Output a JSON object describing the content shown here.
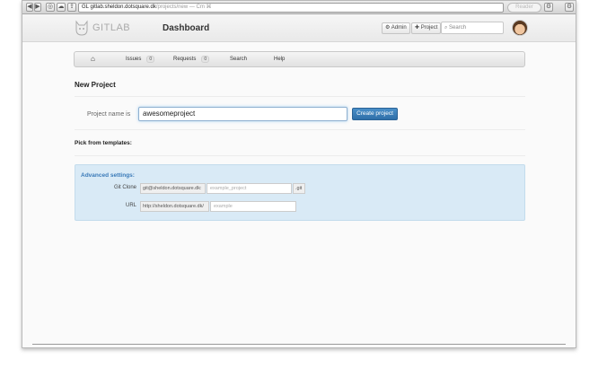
{
  "browser": {
    "url_host": "GL gitlab.sheldon.dotsquare.dk",
    "url_path": "/projects/new — Cm ⌘",
    "reader_label": "Reader"
  },
  "header": {
    "logo_text": "GITLAB",
    "title": "Dashboard",
    "admin_label": "Admin",
    "project_label": "Project",
    "search_placeholder": "Search"
  },
  "nav": {
    "items": [
      {
        "label": "Issues",
        "count": "0"
      },
      {
        "label": "Requests",
        "count": "0"
      },
      {
        "label": "Search"
      },
      {
        "label": "Help"
      }
    ]
  },
  "form": {
    "heading": "New Project",
    "project_name_label": "Project name is",
    "project_name_value": "awesomeproject",
    "create_button": "Create project",
    "templates_label": "Pick from templates:"
  },
  "advanced": {
    "title": "Advanced settings:",
    "git_clone_label": "Git Clone",
    "git_clone_prefix": "git@sheldon.dotsquare.dk:",
    "git_clone_placeholder": "example_project",
    "git_clone_suffix": ".git",
    "url_label": "URL",
    "url_prefix": "http://sheldon.dotsquare.dk/",
    "url_placeholder": "example"
  },
  "colors": {
    "primary_button": "#2f6fa8",
    "advanced_bg": "#d9eaf6",
    "advanced_title": "#3a7ab8"
  }
}
